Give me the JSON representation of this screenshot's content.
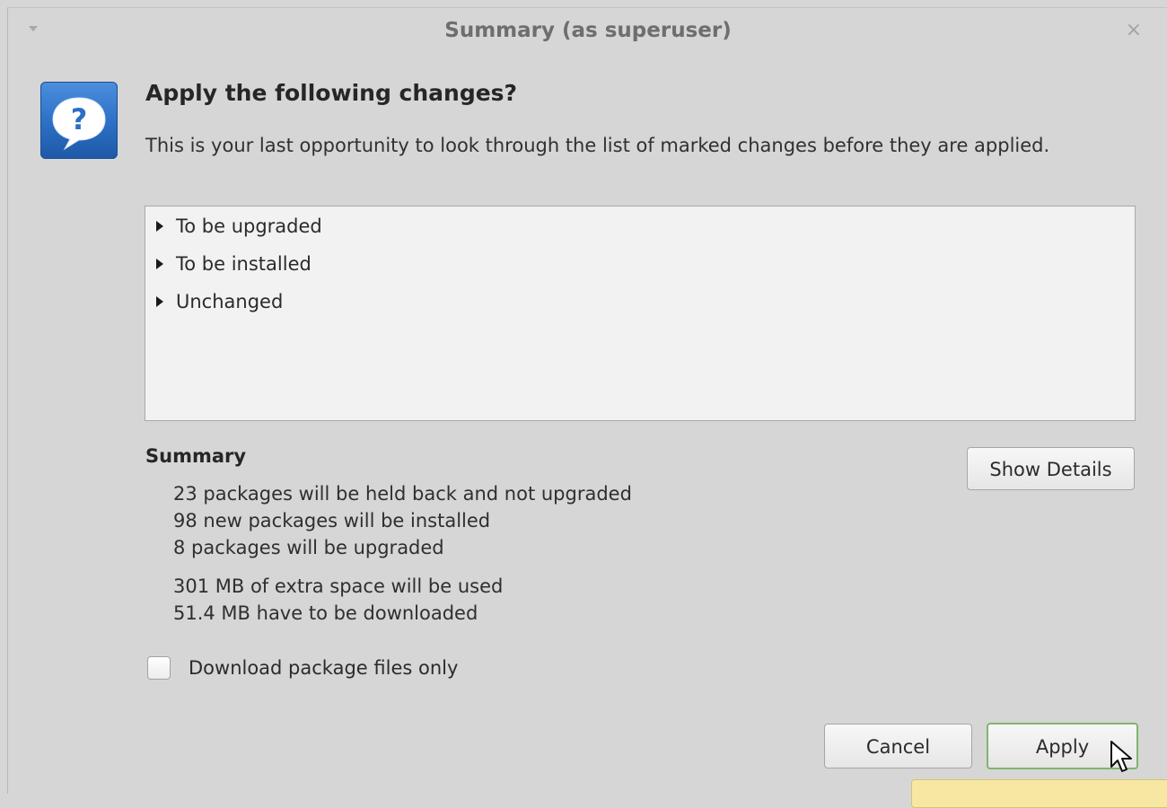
{
  "window": {
    "title": "Summary (as superuser)",
    "close_glyph": "×",
    "menu_icon": "chevron-down-icon"
  },
  "dialog": {
    "icon": "question-icon",
    "icon_glyph": "?",
    "heading": "Apply the following changes?",
    "description": "This is your last opportunity to look through the list of marked changes before they are applied."
  },
  "changes": {
    "items": [
      {
        "label": "To be upgraded",
        "expanded": false
      },
      {
        "label": "To be installed",
        "expanded": false
      },
      {
        "label": "Unchanged",
        "expanded": false
      }
    ]
  },
  "summary": {
    "title": "Summary",
    "lines": [
      "23 packages will be held back and not upgraded",
      "98 new packages will be installed",
      "8 packages will be upgraded"
    ],
    "size_lines": [
      "301 MB of extra space will be used",
      "51.4 MB have to be downloaded"
    ],
    "show_details_label": "Show Details"
  },
  "options": {
    "download_only_label": "Download package files only",
    "download_only_checked": false
  },
  "buttons": {
    "cancel_label": "Cancel",
    "apply_label": "Apply"
  },
  "colors": {
    "icon_blue": "#2b6fc6",
    "apply_focus_border": "#7fb56f",
    "tooltip_bg": "#f6e7a3"
  }
}
